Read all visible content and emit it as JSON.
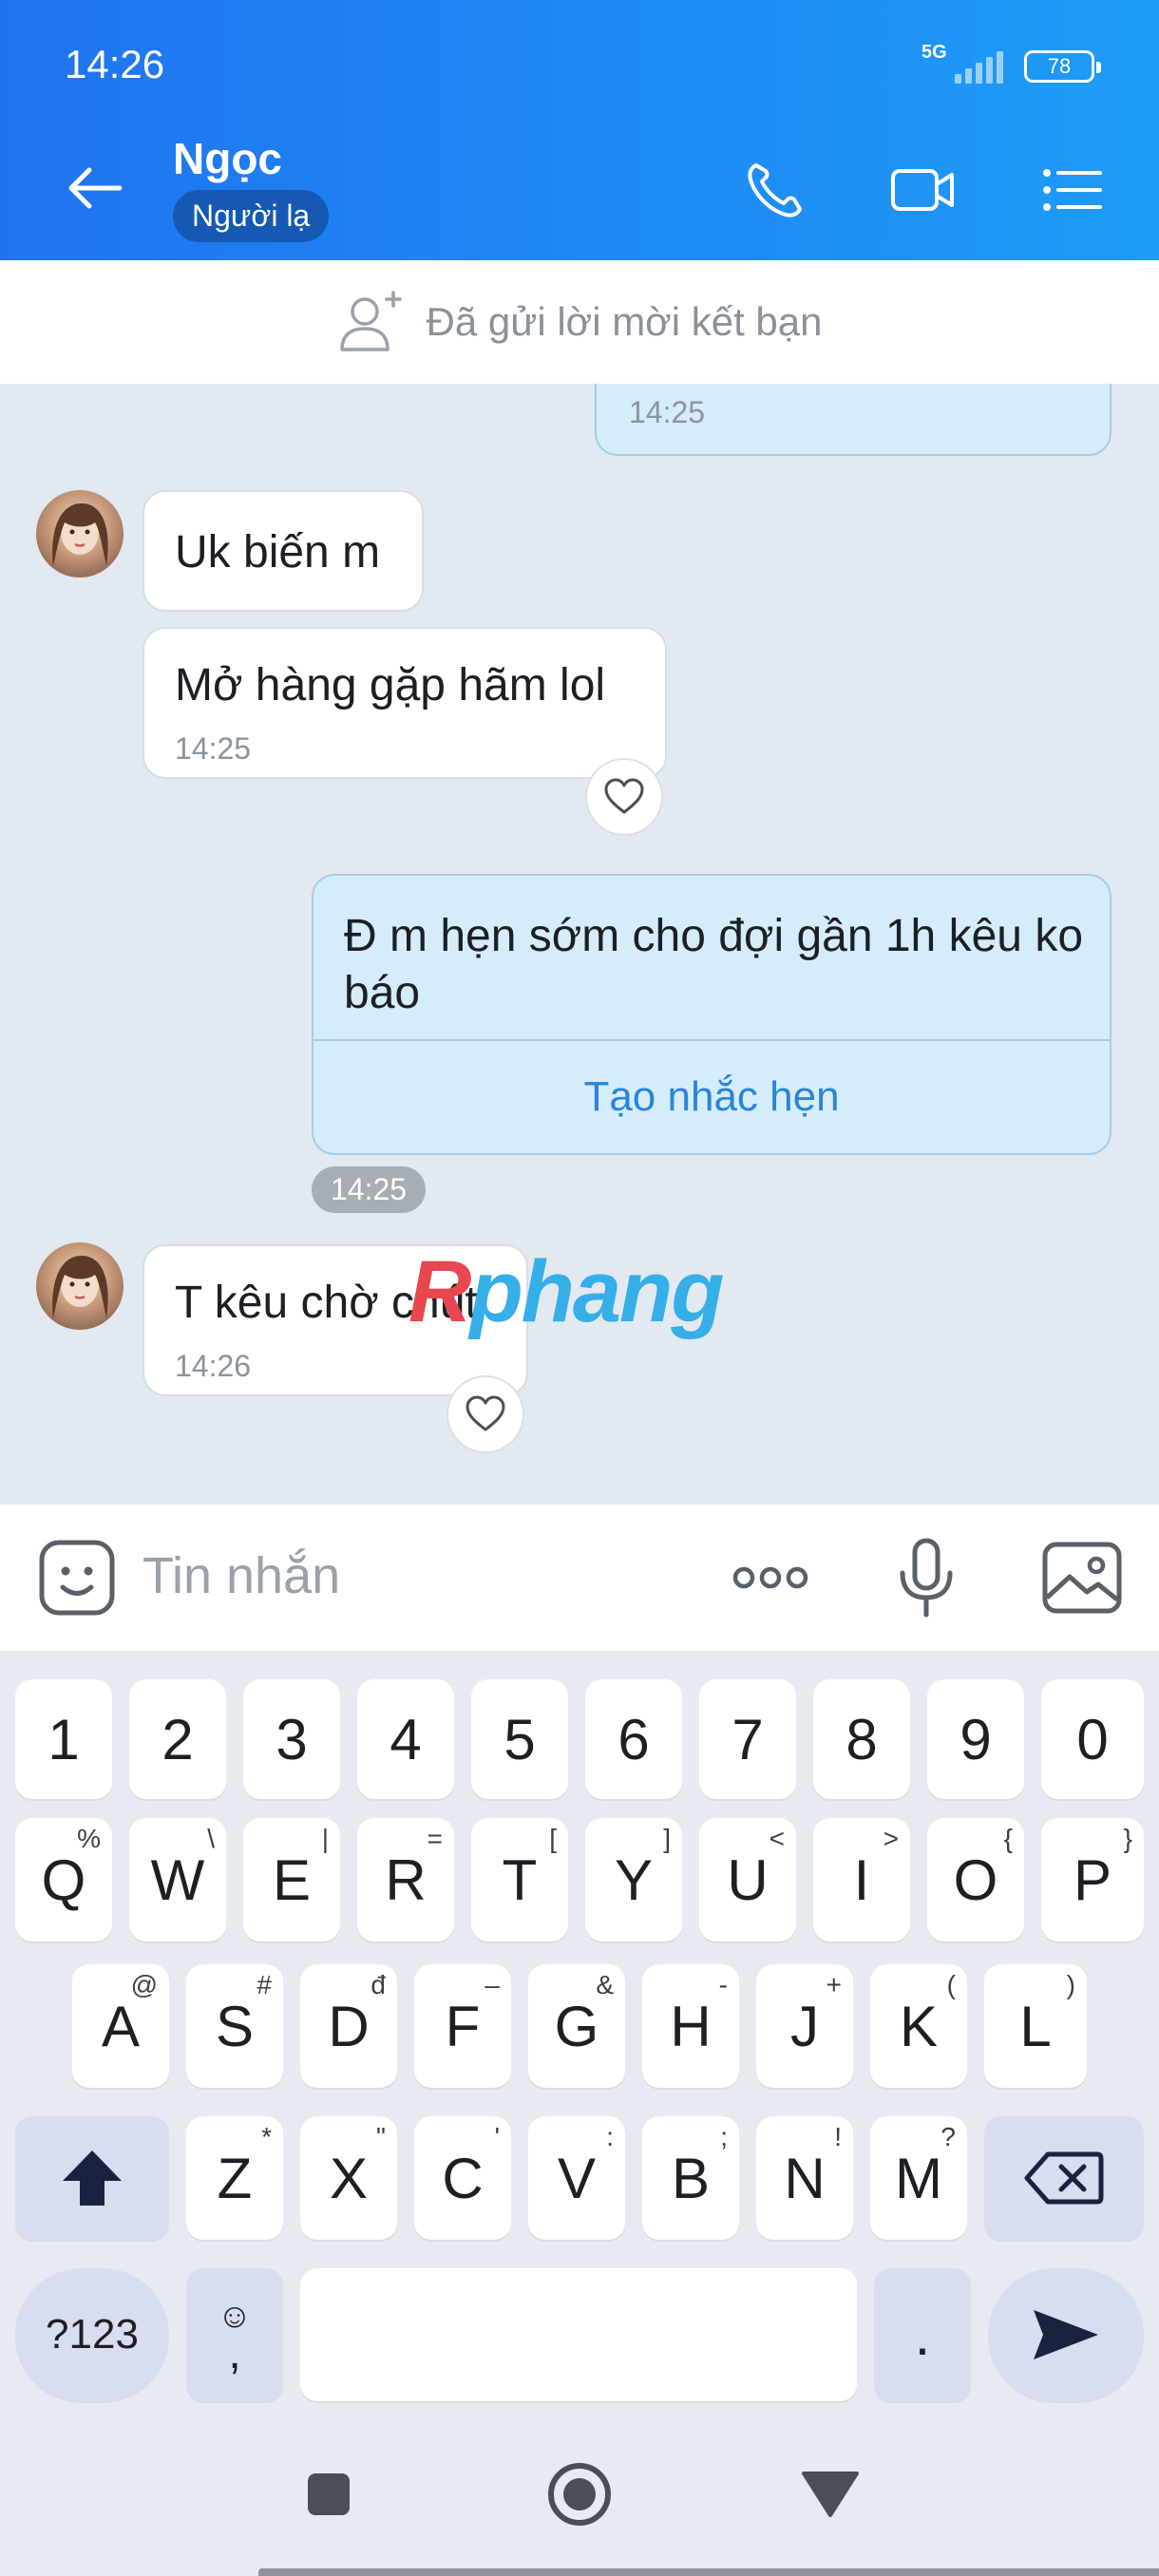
{
  "status_bar": {
    "time": "14:26",
    "network": "5G",
    "battery": "78"
  },
  "header": {
    "contact_name": "Ngọc",
    "badge": "Người lạ"
  },
  "friend_banner": {
    "text": "Đã gửi lời mời kết bạn"
  },
  "messages": [
    {
      "sender": "me",
      "text": "",
      "time": "14:25"
    },
    {
      "sender": "contact",
      "text": "Uk biến m",
      "time": ""
    },
    {
      "sender": "contact",
      "text": "Mở hàng gặp hãm lol",
      "time": "14:25"
    },
    {
      "sender": "me",
      "text": "Đ m hẹn sớm cho đợi gần 1h kêu ko báo",
      "action": "Tạo nhắc hẹn",
      "time": "14:25"
    },
    {
      "sender": "contact",
      "text": "T kêu chờ chút",
      "time": "14:26"
    }
  ],
  "watermark": {
    "part1": "R",
    "part2": "phang"
  },
  "input": {
    "placeholder": "Tin nhắn",
    "value": ""
  },
  "keyboard": {
    "row_numbers": [
      "1",
      "2",
      "3",
      "4",
      "5",
      "6",
      "7",
      "8",
      "9",
      "0"
    ],
    "row_1": [
      {
        "k": "Q",
        "a": "%"
      },
      {
        "k": "W",
        "a": "\\"
      },
      {
        "k": "E",
        "a": "|"
      },
      {
        "k": "R",
        "a": "="
      },
      {
        "k": "T",
        "a": "["
      },
      {
        "k": "Y",
        "a": "]"
      },
      {
        "k": "U",
        "a": "<"
      },
      {
        "k": "I",
        "a": ">"
      },
      {
        "k": "O",
        "a": "{"
      },
      {
        "k": "P",
        "a": "}"
      }
    ],
    "row_2": [
      {
        "k": "A",
        "a": "@"
      },
      {
        "k": "S",
        "a": "#"
      },
      {
        "k": "D",
        "a": "đ"
      },
      {
        "k": "F",
        "a": "–"
      },
      {
        "k": "G",
        "a": "&"
      },
      {
        "k": "H",
        "a": "-"
      },
      {
        "k": "J",
        "a": "+"
      },
      {
        "k": "K",
        "a": "("
      },
      {
        "k": "L",
        "a": ")"
      }
    ],
    "row_3": [
      {
        "k": "Z",
        "a": "*"
      },
      {
        "k": "X",
        "a": "\""
      },
      {
        "k": "C",
        "a": "'"
      },
      {
        "k": "V",
        "a": ":"
      },
      {
        "k": "B",
        "a": ";"
      },
      {
        "k": "N",
        "a": "!"
      },
      {
        "k": "M",
        "a": "?"
      }
    ],
    "symbols_key": "?123",
    "emoji_key_top": "☺",
    "emoji_key_bottom": ",",
    "period_key": "."
  },
  "colors": {
    "header_start": "#1f73f0",
    "header_end": "#1e9cf6",
    "my_bubble": "#d5ecfb",
    "accent": "#2b84d8"
  }
}
